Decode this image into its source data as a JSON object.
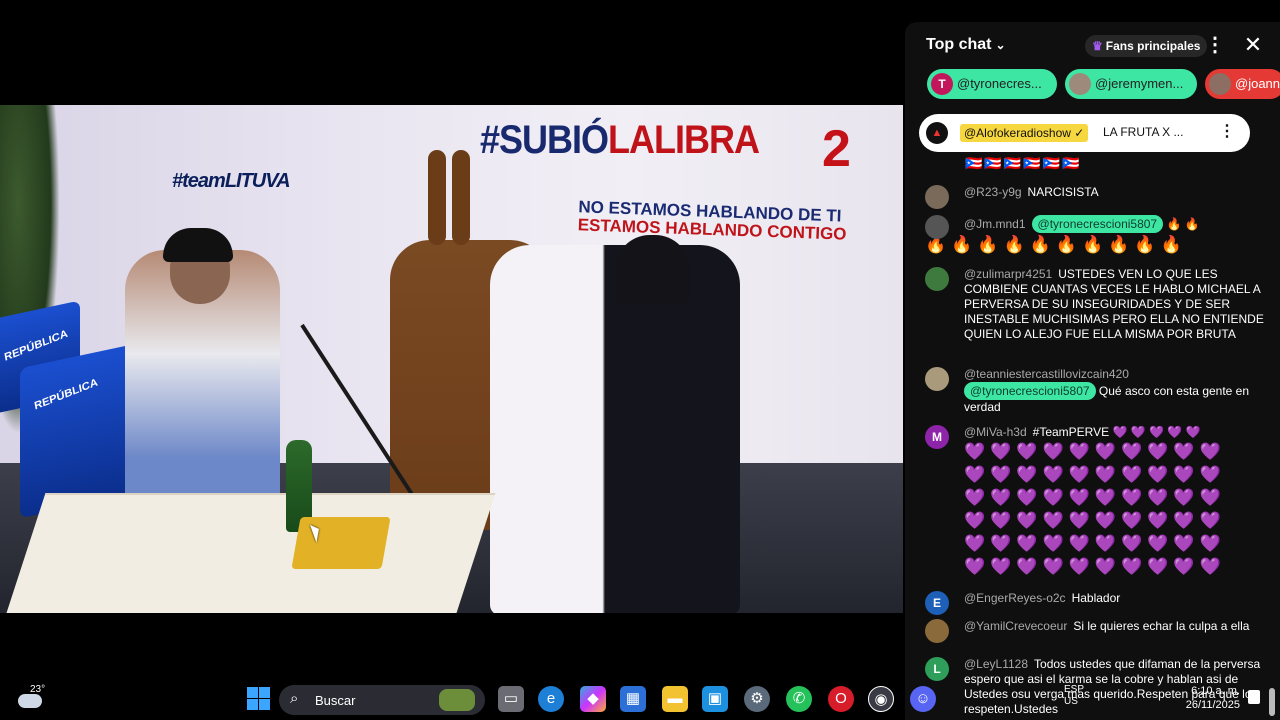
{
  "video": {
    "wall_logo_text": "#teamLITUVA",
    "hashtag_prefix": "#SUBIÓ",
    "hashtag_suffix": "LALIBRA",
    "number_badge": "2",
    "slogan_line1": "NO ESTAMOS HABLANDO DE TI",
    "slogan_line2": "ESTAMOS HABLANDO CONTIGO",
    "chair_logo_1": "REPÚBLICA",
    "chair_logo_2": "REPÚBLICA"
  },
  "chat": {
    "title": "Top chat",
    "fans_label": "Fans principales",
    "tickers": [
      {
        "initial": "T",
        "user": "@tyronecres...",
        "bg": "#3ee6a4",
        "avatar_bg": "#c2185b"
      },
      {
        "initial": "",
        "user": "@jeremymen...",
        "bg": "#3ee6a4",
        "avatar_bg": "#9e8a7a"
      },
      {
        "initial": "",
        "user": "@joann",
        "bg": "#e53935",
        "avatar_bg": "#8d6e63"
      }
    ],
    "pinned": {
      "avatar_glyph": "▲",
      "user": "@Alofokeradioshow ✓",
      "message": "LA FRUTA X ..."
    },
    "flags": "🇵🇷🇵🇷🇵🇷🇵🇷🇵🇷🇵🇷",
    "messages": [
      {
        "user": "@R23-y9g",
        "text": "NARCISISTA",
        "avatar_bg": "#7a6a5a",
        "initial": ""
      },
      {
        "user": "@Jm.mnd1",
        "mention": "@tyronecrescioni5807",
        "emoji": "🔥 🔥",
        "emoji_line": "🔥🔥🔥🔥🔥🔥🔥🔥🔥🔥",
        "avatar_bg": "#555",
        "initial": ""
      },
      {
        "user": "@zulimarpr4251",
        "text": "USTEDES VEN LO QUE LES COMBIENE CUANTAS VECES LE HABLO MICHAEL A PERVERSA DE SU INSEGURIDADES Y DE SER INESTABLE MUCHISIMAS PERO ELLA NO ENTIENDE QUIEN LO ALEJO FUE ELLA MISMA POR BRUTA",
        "avatar_bg": "#3e7a3e",
        "initial": ""
      },
      {
        "user": "@teanniestercastillovizcain420",
        "mention": "@tyronecrescioni5807",
        "text": "Qué asco con esta gente en verdad",
        "avatar_bg": "#a89a7a",
        "initial": ""
      },
      {
        "user": "@MiVa-h3d",
        "text": "#TeamPERVE",
        "emoji": "💜 💜 💜 💜 💜",
        "emoji_grid": [
          "💜💜💜💜💜💜💜💜💜💜",
          "💜💜💜💜💜💜💜💜💜💜",
          "💜💜💜💜💜💜💜💜💜💜",
          "💜💜💜💜💜💜💜💜💜💜",
          "💜💜💜💜💜💜💜💜💜💜",
          "💜💜💜💜💜💜💜💜💜💜"
        ],
        "avatar_bg": "#8e24aa",
        "initial": "M"
      },
      {
        "user": "@EngerReyes-o2c",
        "text": "Hablador",
        "avatar_bg": "#1e5fb8",
        "initial": "E"
      },
      {
        "user": "@YamilCrevecoeur",
        "text": "Si le quieres echar la culpa a ella",
        "avatar_bg": "#8a6a3a",
        "initial": ""
      },
      {
        "user": "@LeyL1128",
        "text": "Todos ustedes que difaman de la perversa espero que asi el karma se la cobre y hablan asi de Ustedes osu verga mas querido.Respeten para que lo respeten.Ustedes",
        "avatar_bg": "#2e9e5a",
        "initial": "L"
      }
    ]
  },
  "taskbar": {
    "temperature": "23°",
    "search_placeholder": "Buscar",
    "lang": "ESP",
    "lang2": "US",
    "time": "6:10 a. m.",
    "date": "26/11/2025",
    "apps": [
      "file-explorer",
      "edge",
      "copilot",
      "store",
      "folder",
      "widgets",
      "settings",
      "whatsapp",
      "opera",
      "obs",
      "discord"
    ]
  }
}
